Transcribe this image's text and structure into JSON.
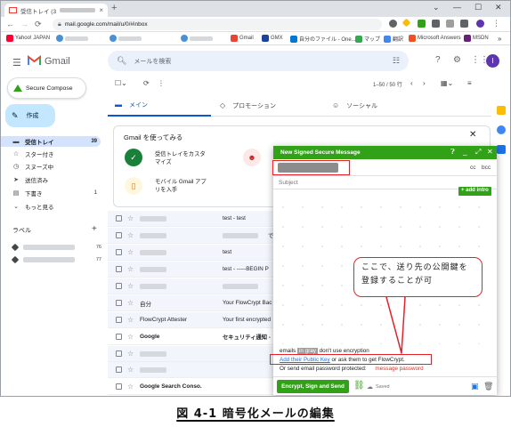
{
  "browser": {
    "tab_title": "受信トレイ (39) -",
    "tab_close": "×",
    "new_tab": "+",
    "win_min": "—",
    "win_max": "☐",
    "win_close": "✕",
    "back": "←",
    "forward": "→",
    "reload": "⟳",
    "url": "mail.google.com/mail/u/0/#inbox",
    "bookmarks": [
      {
        "label": "Yahoo! JAPAN",
        "color": "#ff0033"
      },
      {
        "label": "",
        "color": "#4a90d9"
      },
      {
        "label": "",
        "color": "#4a90d9"
      },
      {
        "label": "",
        "color": "#4a90d9"
      },
      {
        "label": "Gmail",
        "color": "#ea4335"
      },
      {
        "label": "GMX",
        "color": "#1c449b"
      },
      {
        "label": "自分のファイル - One...",
        "color": "#0078d4"
      },
      {
        "label": "マップ",
        "color": "#34a853"
      },
      {
        "label": "翻訳",
        "color": "#4285f4"
      },
      {
        "label": "Microsoft Answers",
        "color": "#f25022"
      },
      {
        "label": "MSDN",
        "color": "#68217a"
      }
    ],
    "bookmarks_more": "»"
  },
  "gmail": {
    "brand": "Gmail",
    "search_placeholder": "メールを検索",
    "avatar_letter": "I",
    "secure_compose": "Secure Compose",
    "compose": "作成",
    "nav": [
      {
        "icon": "inbox-icon",
        "glyph": "▬",
        "label": "受信トレイ",
        "count": "39",
        "active": true
      },
      {
        "icon": "star-icon",
        "glyph": "☆",
        "label": "スター付き",
        "count": "",
        "active": false
      },
      {
        "icon": "snooze-icon",
        "glyph": "◷",
        "label": "スヌーズ中",
        "count": "",
        "active": false
      },
      {
        "icon": "sent-icon",
        "glyph": "➤",
        "label": "送信済み",
        "count": "",
        "active": false
      },
      {
        "icon": "draft-icon",
        "glyph": "▤",
        "label": "下書き",
        "count": "1",
        "active": false
      },
      {
        "icon": "more-icon",
        "glyph": "⌄",
        "label": "もっと見る",
        "count": "",
        "active": false
      }
    ],
    "labels_heading": "ラベル",
    "labels_add": "+",
    "label_rows": [
      {
        "count": "76"
      },
      {
        "count": "77"
      }
    ],
    "pager": "1–50 / 50 行",
    "tabs": [
      {
        "icon": "inbox-tab-icon",
        "glyph": "▬",
        "label": "メイン",
        "active": true
      },
      {
        "icon": "tag-icon",
        "glyph": "◇",
        "label": "プロモーション",
        "active": false
      },
      {
        "icon": "people-icon",
        "glyph": "☺",
        "label": "ソーシャル",
        "active": false
      }
    ],
    "card": {
      "title": "Gmail を使ってみる",
      "close": "✕",
      "item1": "受信トレイをカスタマイズ",
      "item2": "モバイル Gmail アプリを入手"
    },
    "rows": [
      {
        "sender": "",
        "subject": "test - test",
        "unread": false
      },
      {
        "sender": "",
        "subject": "",
        "unread": false
      },
      {
        "sender": "",
        "subject": "test",
        "unread": false
      },
      {
        "sender": "",
        "subject": "test - -----BEGIN P",
        "unread": false
      },
      {
        "sender": "",
        "subject": "",
        "unread": false
      },
      {
        "sender": "自分",
        "subject": "Your FlowCrypt Bac",
        "unread": false
      },
      {
        "sender": "FlowCrypt Attester",
        "subject": "Your first encrypted",
        "unread": false
      },
      {
        "sender": "Google",
        "subject": "セキュリティ通知 -",
        "unread": true
      },
      {
        "sender": "",
        "subject": "",
        "unread": false
      },
      {
        "sender": "",
        "subject": "",
        "unread": false
      },
      {
        "sender": "Google Search Conso.",
        "subject": "",
        "unread": true
      }
    ],
    "row_fragment_de": "で"
  },
  "compose_window": {
    "title": "New Signed Secure Message",
    "cc": "cc",
    "bcc": "bcc",
    "subject_placeholder": "Subject",
    "add_intro": "+ add intro",
    "info_prefix": "emails",
    "info_pill": "in gray",
    "info_suffix": "don't use encryption",
    "pubkey_link": "Add their Public Key",
    "pubkey_suffix": "or ask them to get FlowCrypt.",
    "pwd_prefix": "Or send email password protected:",
    "pwd_link": "message password",
    "send_button": "Encrypt, Sign and Send",
    "saved": "Saved"
  },
  "annotation": {
    "callout_text": "ここで、送り先の公開鍵を登録することが可"
  },
  "figure_caption": "図 4-1 暗号化メールの編集",
  "colors": {
    "flowcrypt_green": "#31a217",
    "annotation_red": "#e8202a",
    "gmail_active_nav": "#d3e3fd",
    "compose_blue": "#c2e7ff"
  }
}
